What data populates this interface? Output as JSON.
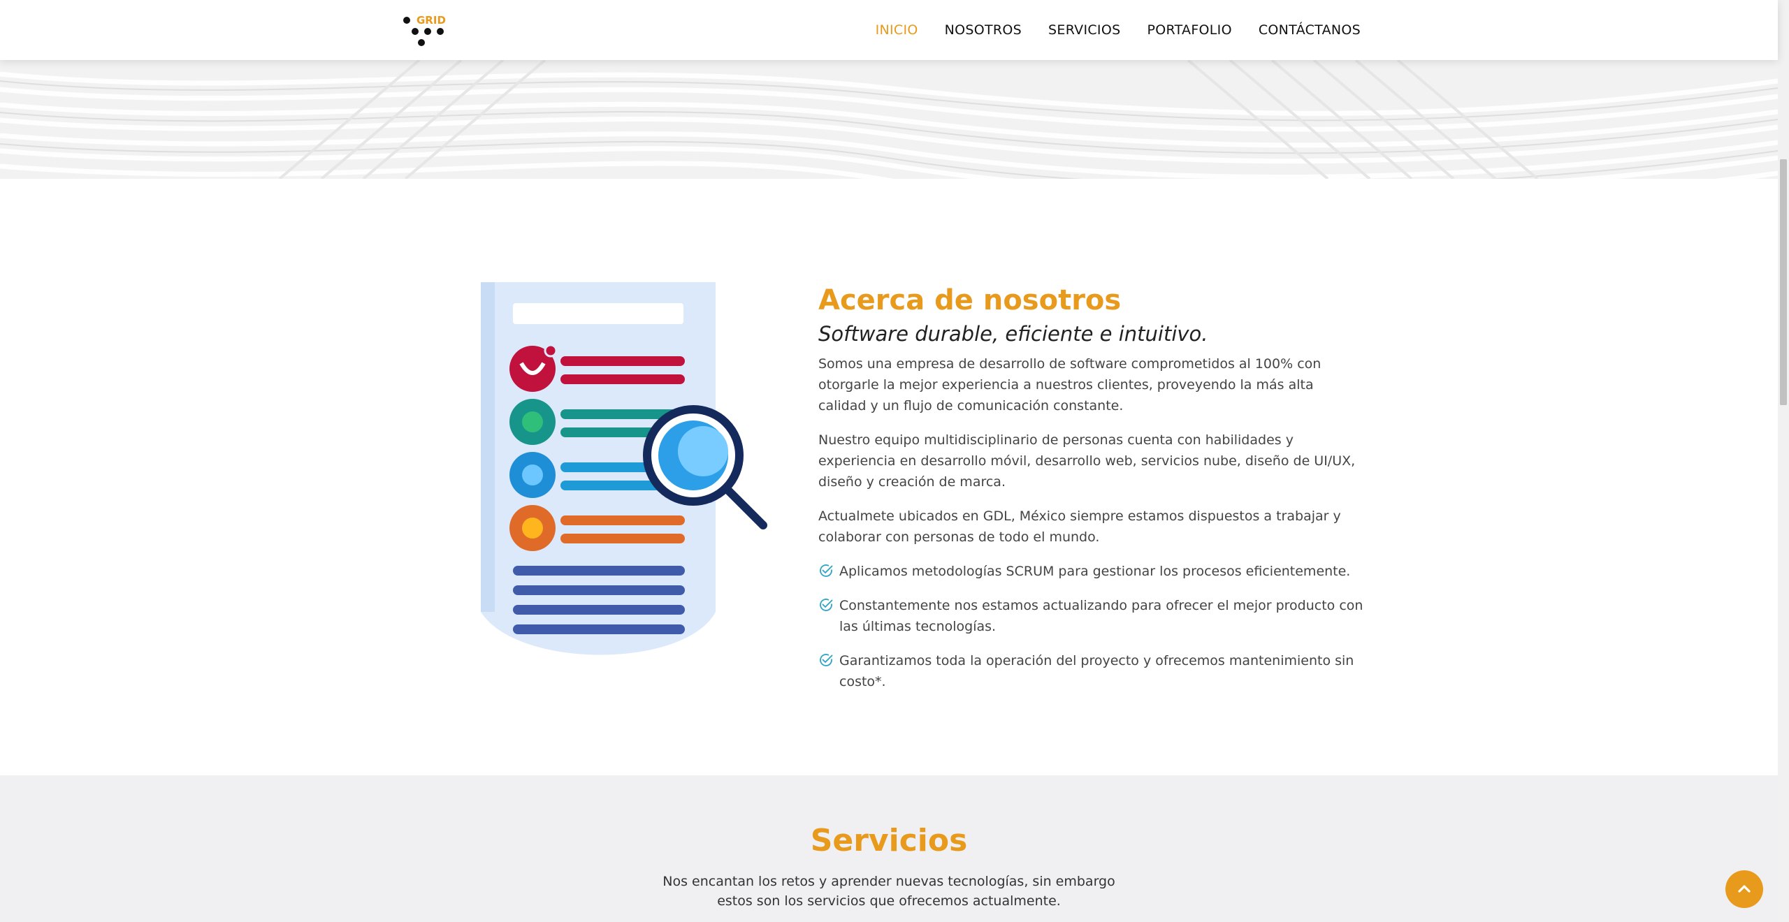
{
  "brand": {
    "logo_text": "GRID",
    "accent_color": "#e89a1c"
  },
  "nav": {
    "items": [
      {
        "label": "INICIO",
        "active": true
      },
      {
        "label": "NOSOTROS",
        "active": false
      },
      {
        "label": "SERVICIOS",
        "active": false
      },
      {
        "label": "PORTAFOLIO",
        "active": false
      },
      {
        "label": "CONTÁCTANOS",
        "active": false
      }
    ]
  },
  "about": {
    "title": "Acerca de nosotros",
    "subtitle": "Software durable, eficiente e intuitivo.",
    "paragraphs": [
      "Somos una empresa de desarrollo de software comprometidos al 100% con otorgarle la mejor experiencia a nuestros clientes, proveyendo la más alta calidad y un flujo de comunicación constante.",
      "Nuestro equipo multidisciplinario de personas cuenta con habilidades y experiencia en desarrollo móvil, desarrollo web, servicios nube, diseño de UI/UX, diseño y creación de marca.",
      "Actualmete ubicados en GDL, México siempre estamos dispuestos a trabajar y colaborar con personas de todo el mundo."
    ],
    "checks": [
      "Aplicamos metodologías SCRUM para gestionar los procesos eficientemente.",
      "Constantemente nos estamos actualizando para ofrecer el mejor producto con las últimas tecnologías.",
      "Garantizamos toda la operación del proyecto y ofrecemos mantenimiento sin costo*."
    ],
    "check_icon": "check-circle-icon",
    "illustration_icon": "document-search-icon"
  },
  "services": {
    "title": "Servicios",
    "description": "Nos encantan los retos y aprender nuevas tecnologías, sin embargo estos son los servicios que ofrecemos actualmente."
  },
  "back_to_top": {
    "icon": "chevron-up-icon"
  }
}
